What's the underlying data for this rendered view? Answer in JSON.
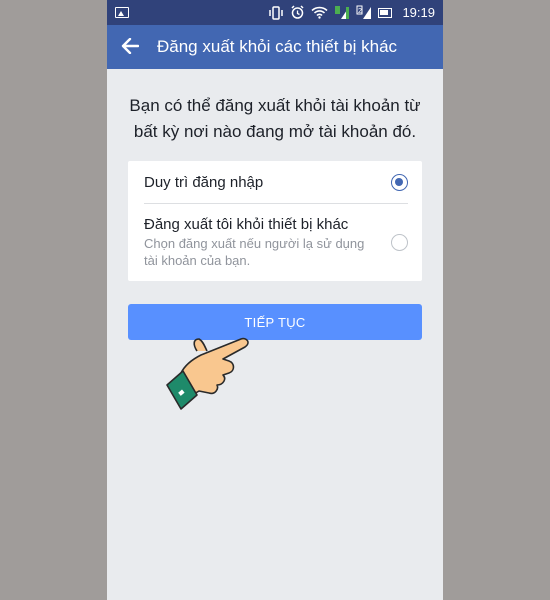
{
  "statusbar": {
    "time": "19:19"
  },
  "appbar": {
    "title": "Đăng xuất khỏi các thiết bị khác"
  },
  "intro": {
    "text": "Bạn có thể đăng xuất khỏi tài khoản từ bất kỳ nơi nào đang mở tài khoản đó."
  },
  "options": [
    {
      "title": "Duy trì đăng nhập",
      "subtitle": "",
      "selected": true
    },
    {
      "title": "Đăng xuất tôi khỏi thiết bị khác",
      "subtitle": "Chọn đăng xuất nếu người lạ sử dụng tài khoản của bạn.",
      "selected": false
    }
  ],
  "continue_button": {
    "label": "TIẾP TỤC"
  },
  "colors": {
    "statusbar": "#30427a",
    "appbar": "#4267b2",
    "button": "#5890ff",
    "background": "#e9ebee"
  }
}
